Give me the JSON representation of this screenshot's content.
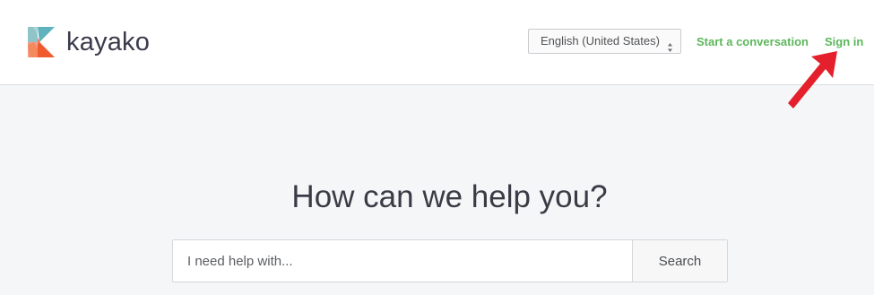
{
  "brand": {
    "name": "kayako",
    "logo_icon": "kayako-k-icon"
  },
  "header": {
    "language_select": {
      "value": "English (United States)",
      "caret_icon": "select-caret-icon"
    },
    "start_conversation_label": "Start a conversation",
    "sign_in_label": "Sign in",
    "link_color": "#5db65c",
    "annotation_arrow": {
      "icon": "red-arrow-icon",
      "color": "#e3202b"
    }
  },
  "hero": {
    "title": "How can we help you?"
  },
  "search": {
    "placeholder": "I need help with...",
    "value": "",
    "button_label": "Search"
  }
}
